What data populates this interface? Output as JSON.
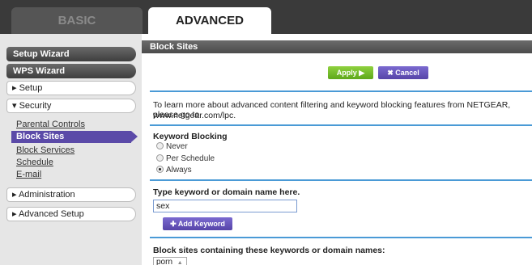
{
  "tabs": {
    "basic": "BASIC",
    "advanced": "ADVANCED"
  },
  "sidebar": {
    "setup_wizard": "Setup Wizard",
    "wps_wizard": "WPS Wizard",
    "setup": "▸ Setup",
    "security": "▾ Security",
    "security_items": [
      "Parental Controls",
      "Block Sites",
      "Block Services",
      "Schedule",
      "E-mail"
    ],
    "administration": "▸ Administration",
    "advanced_setup": "▸ Advanced Setup"
  },
  "main": {
    "title": "Block Sites",
    "apply_label": "Apply ▶",
    "cancel_label": "✖ Cancel",
    "info_line1": "To learn more about advanced content filtering and keyword blocking features from NETGEAR, please go to",
    "info_line2": "www.netgear.com/lpc.",
    "keyword_blocking_heading": "Keyword Blocking",
    "radio_options": [
      "Never",
      "Per Schedule",
      "Always"
    ],
    "selected_option": "Always",
    "type_keyword_label": "Type keyword or domain name here.",
    "keyword_input_value": "sex",
    "add_keyword_label": "✚ Add Keyword",
    "block_list_heading": "Block sites containing these keywords or domain names:",
    "block_list_item": "porn",
    "block_list_arrow": "▲"
  },
  "colors": {
    "accent_blue": "#4a9ad6",
    "active_purple": "#5b4aa8",
    "apply_green": "#6cb82a"
  }
}
